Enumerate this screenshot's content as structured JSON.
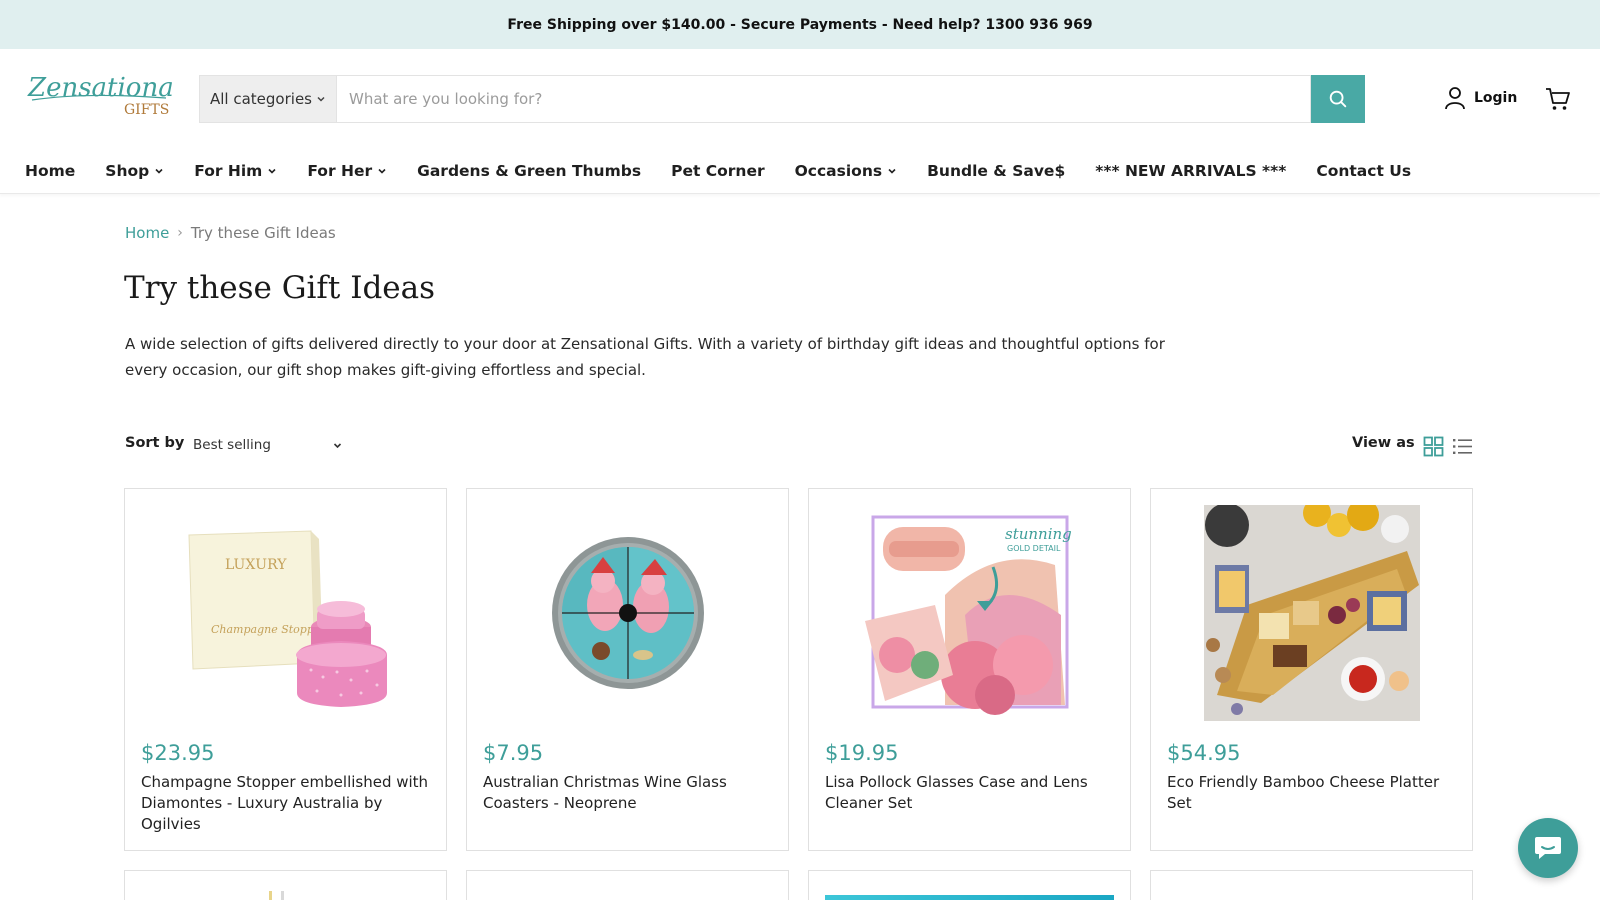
{
  "announcement": "Free Shipping over $140.00 - Secure Payments - Need help? 1300 936 969",
  "brand": {
    "logo_text": "Zensational",
    "logo_sub": "GIFTS",
    "accent": "#3e9e99"
  },
  "search": {
    "category_label": "All categories",
    "placeholder": "What are you looking for?",
    "button_icon": "search-icon"
  },
  "account": {
    "login_label": "Login",
    "cart_icon": "cart-icon"
  },
  "nav": {
    "items": [
      {
        "label": "Home",
        "dropdown": false
      },
      {
        "label": "Shop",
        "dropdown": true
      },
      {
        "label": "For Him",
        "dropdown": true
      },
      {
        "label": "For Her",
        "dropdown": true
      },
      {
        "label": "Gardens & Green Thumbs",
        "dropdown": false
      },
      {
        "label": "Pet Corner",
        "dropdown": false
      },
      {
        "label": "Occasions",
        "dropdown": true
      },
      {
        "label": "Bundle & Save$",
        "dropdown": false
      },
      {
        "label": "*** NEW ARRIVALS ***",
        "dropdown": false
      },
      {
        "label": "Contact Us",
        "dropdown": false
      }
    ]
  },
  "breadcrumb": {
    "home": "Home",
    "separator": "›",
    "current": "Try these Gift Ideas"
  },
  "page": {
    "title": "Try these Gift Ideas",
    "description": "A wide selection of gifts delivered directly to your door at Zensational Gifts. With a variety of birthday gift ideas and thoughtful options for every occasion, our gift shop makes gift-giving effortless and special."
  },
  "toolbar": {
    "sort_label": "Sort by",
    "sort_value": "Best selling",
    "view_label": "View as",
    "view_modes": [
      "grid-view-icon",
      "list-view-icon"
    ]
  },
  "products": [
    {
      "price": "$23.95",
      "title": "Champagne Stopper embellished with Diamontes - Luxury Australia by Ogilvies",
      "image": "champagne-stopper-image"
    },
    {
      "price": "$7.95",
      "title": "Australian Christmas Wine Glass Coasters - Neoprene",
      "image": "coaster-image"
    },
    {
      "price": "$19.95",
      "title": "Lisa Pollock Glasses Case and Lens Cleaner Set",
      "image": "glasses-case-image"
    },
    {
      "price": "$54.95",
      "title": "Eco Friendly Bamboo Cheese Platter Set",
      "image": "cheese-platter-image"
    }
  ],
  "product_images": {
    "box_label": "LUXURY",
    "box_script": "Champagne Stopper",
    "badge_line1": "stunning",
    "badge_line2": "GOLD DETAIL"
  },
  "chat": {
    "icon": "chat-icon"
  }
}
